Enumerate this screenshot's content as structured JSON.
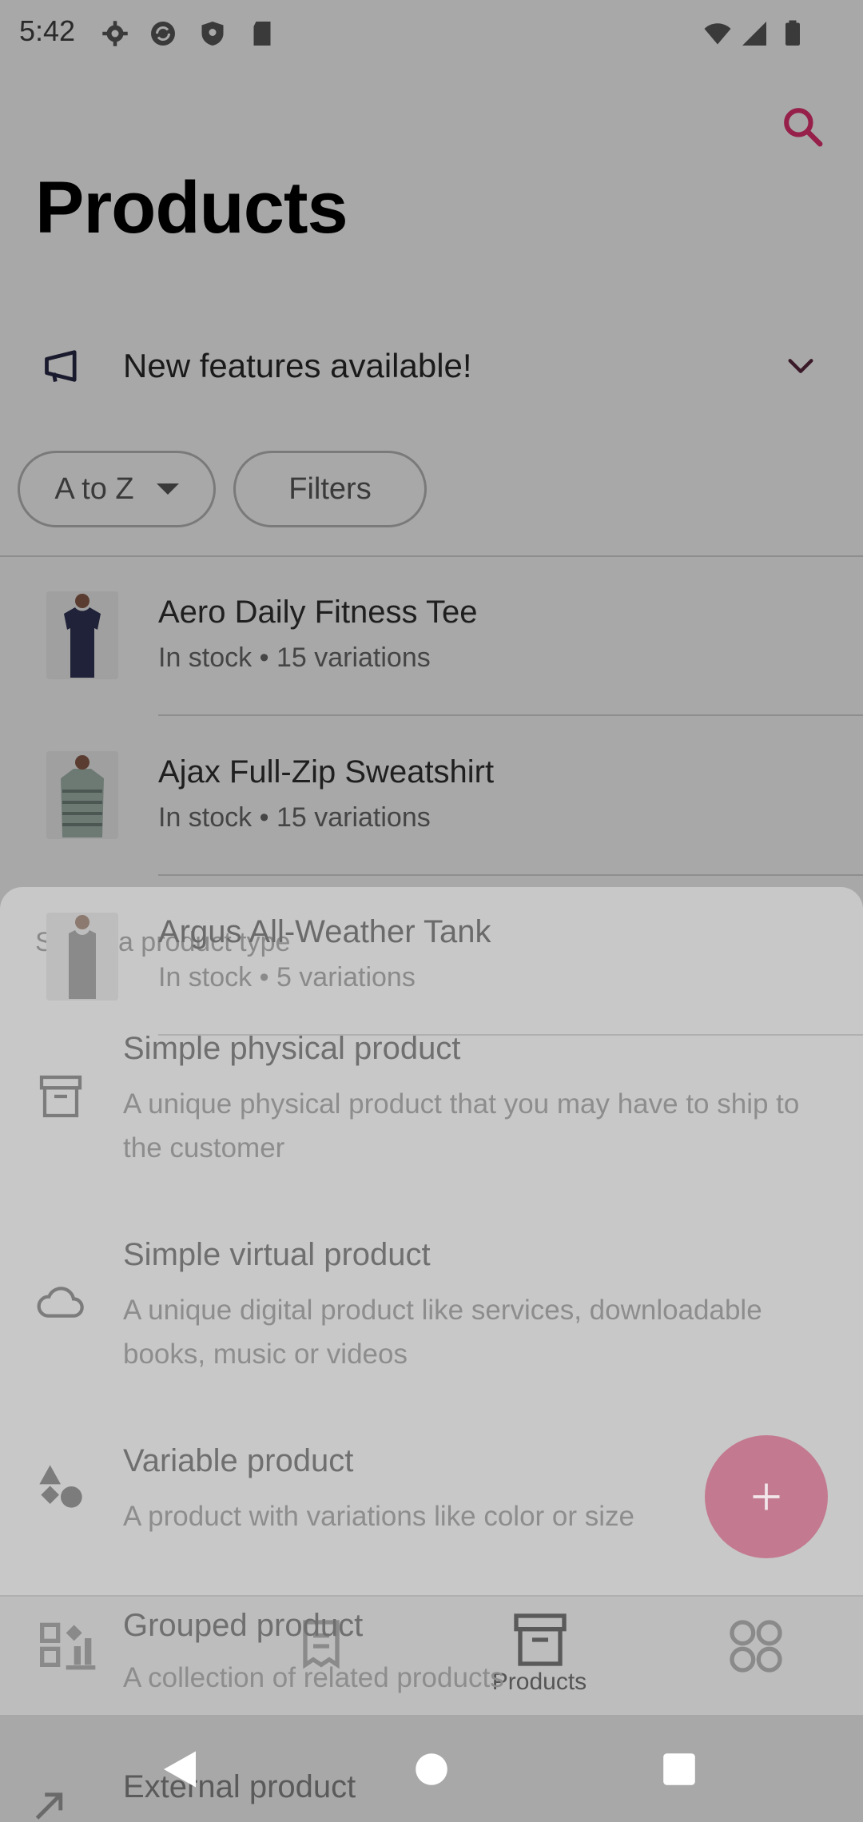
{
  "status_bar": {
    "time": "5:42"
  },
  "header": {
    "title": "Products",
    "search_icon": "search-icon"
  },
  "banner": {
    "text": "New features available!",
    "icon": "megaphone-icon",
    "chevron": "chevron-down-icon"
  },
  "filters": {
    "sort_label": "A to Z",
    "filters_label": "Filters"
  },
  "products": [
    {
      "name": "Aero Daily Fitness Tee",
      "status": "In stock • 15 variations"
    },
    {
      "name": "Ajax Full-Zip Sweatshirt",
      "status": "In stock • 15 variations"
    },
    {
      "name": "Argus All-Weather Tank",
      "status": "In stock • 5 variations"
    }
  ],
  "sheet": {
    "title": "Select a product type",
    "options": [
      {
        "title": "Simple physical product",
        "description": "A unique physical product that you may have to ship to the customer",
        "icon": "archive-box-icon"
      },
      {
        "title": "Simple virtual product",
        "description": "A unique digital product like services, downloadable books, music or videos",
        "icon": "cloud-icon"
      },
      {
        "title": "Variable product",
        "description": "A product with variations like color or size",
        "icon": "shapes-icon"
      },
      {
        "title": "Grouped product",
        "description": "A collection of related products",
        "icon": "grouped-icon"
      },
      {
        "title": "External product",
        "description": "",
        "icon": "external-link-icon"
      }
    ]
  },
  "bottom_nav": {
    "items": [
      {
        "icon": "dashboard-icon",
        "label": ""
      },
      {
        "icon": "orders-icon",
        "label": ""
      },
      {
        "icon": "products-icon",
        "label": "Products"
      },
      {
        "icon": "more-icon",
        "label": ""
      }
    ]
  },
  "fab": {
    "icon": "plus-icon"
  },
  "colors": {
    "accent": "#96204a",
    "fab": "#c37a90"
  }
}
